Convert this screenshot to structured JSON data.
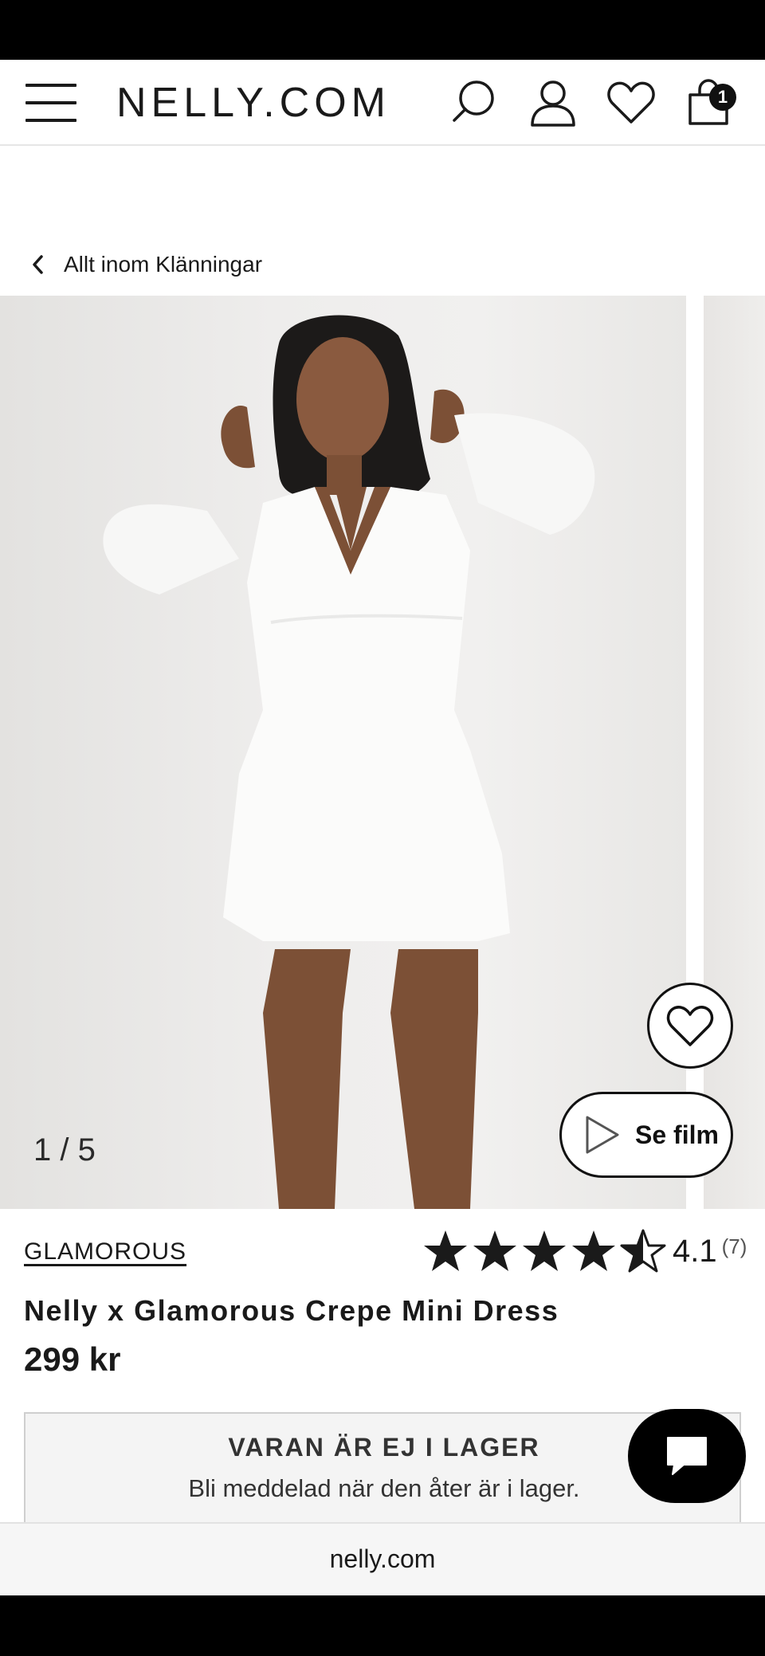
{
  "header": {
    "logo": "NELLY.COM",
    "cart_count": "1"
  },
  "breadcrumb": {
    "label": "Allt inom Klänningar"
  },
  "gallery": {
    "counter": "1 / 5",
    "video_button_label": "Se film"
  },
  "product": {
    "brand": "GLAMOROUS",
    "rating_value": "4.1",
    "rating_count": "(7)",
    "rating_stars": 4.1,
    "title": "Nelly x Glamorous Crepe Mini Dress",
    "price": "299 kr"
  },
  "stock": {
    "title": "VARAN ÄR EJ I LAGER",
    "subtitle": "Bli meddelad när den åter är i lager."
  },
  "browser": {
    "url": "nelly.com"
  },
  "icons": [
    "menu-icon",
    "search-icon",
    "user-icon",
    "heart-icon",
    "bag-icon",
    "chevron-left-icon",
    "heart-outline-icon",
    "play-icon",
    "star-icon",
    "chat-icon"
  ]
}
